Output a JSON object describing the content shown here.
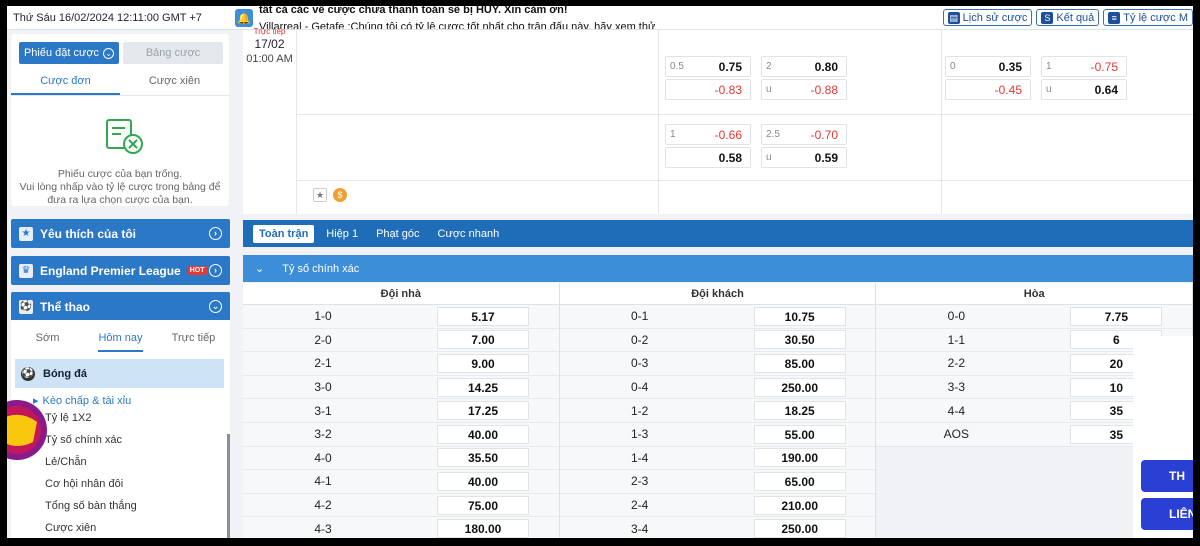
{
  "topbar": {
    "datetime": "Thứ Sáu 16/02/2024 12:11:00 GMT +7",
    "marquee_line1": "tất cả các về cược chưa thanh toán sẽ bị HỦY. Xin cảm ơn!",
    "marquee_line2": "Villarreal - Getafe :Chúng tôi có tỷ lệ cược tốt nhất cho trận đấu này, hãy xem thử",
    "buttons": [
      {
        "label": "Lịch sử cược",
        "icon": "history-icon"
      },
      {
        "label": "Kết quả",
        "icon": "results-icon"
      },
      {
        "label": "Tỷ lệ cược M",
        "icon": "odds-icon"
      }
    ]
  },
  "slip": {
    "tab_active": "Phiếu đặt cược",
    "tab_inactive": "Bảng cược",
    "sub_single": "Cược đơn",
    "sub_multi": "Cược xiên",
    "empty_line1": "Phiếu cược của bạn trống.",
    "empty_line2": "Vui lòng nhấp vào tỷ lệ cược trong bảng để",
    "empty_line3": "đưa ra lựa chọn cược của bạn."
  },
  "sidebar": {
    "favorites": "Yêu thích của tôi",
    "league": "England Premier League",
    "hot": "HOT",
    "sports": "Thể thao",
    "tabs": [
      "Sớm",
      "Hôm nay",
      "Trực tiếp"
    ],
    "sport_main": "Bóng đá",
    "sport_sub": "Kèo chấp & tài xỉu",
    "items": [
      "Tỷ lệ 1X2",
      "Tỷ số chính xác",
      "Lẻ/Chẵn",
      "Cơ hội nhân đôi",
      "Tổng số bàn thắng",
      "Cược xiên"
    ]
  },
  "match": {
    "live_label": "Trực tiếp",
    "date": "17/02",
    "time": "01:00 AM",
    "odds": [
      {
        "h": "0.5",
        "v": "0.75",
        "neg": false
      },
      {
        "h": "",
        "v": "-0.83",
        "neg": true
      },
      {
        "h": "2",
        "v": "0.80",
        "neg": false
      },
      {
        "h": "u",
        "v": "-0.88",
        "neg": true
      },
      {
        "h": "0",
        "v": "0.35",
        "neg": false
      },
      {
        "h": "",
        "v": "-0.45",
        "neg": true
      },
      {
        "h": "1",
        "v": "-0.75",
        "neg": true
      },
      {
        "h": "u",
        "v": "0.64",
        "neg": false
      },
      {
        "h": "1",
        "v": "-0.66",
        "neg": true
      },
      {
        "h": "",
        "v": "0.58",
        "neg": false
      },
      {
        "h": "2.5",
        "v": "-0.70",
        "neg": true
      },
      {
        "h": "u",
        "v": "0.59",
        "neg": false
      }
    ]
  },
  "tabs": [
    "Toàn trận",
    "Hiệp 1",
    "Phạt góc",
    "Cược nhanh"
  ],
  "section_title": "Tỷ số chính xác",
  "table": {
    "headers": [
      "Đội nhà",
      "Đội khách",
      "Hòa"
    ],
    "home": [
      [
        "1-0",
        "5.17"
      ],
      [
        "2-0",
        "7.00"
      ],
      [
        "2-1",
        "9.00"
      ],
      [
        "3-0",
        "14.25"
      ],
      [
        "3-1",
        "17.25"
      ],
      [
        "3-2",
        "40.00"
      ],
      [
        "4-0",
        "35.50"
      ],
      [
        "4-1",
        "40.00"
      ],
      [
        "4-2",
        "75.00"
      ],
      [
        "4-3",
        "180.00"
      ]
    ],
    "away": [
      [
        "0-1",
        "10.75"
      ],
      [
        "0-2",
        "30.50"
      ],
      [
        "0-3",
        "85.00"
      ],
      [
        "0-4",
        "250.00"
      ],
      [
        "1-2",
        "18.25"
      ],
      [
        "1-3",
        "55.00"
      ],
      [
        "1-4",
        "190.00"
      ],
      [
        "2-3",
        "65.00"
      ],
      [
        "2-4",
        "210.00"
      ],
      [
        "3-4",
        "250.00"
      ]
    ],
    "draw": [
      [
        "0-0",
        "7.75"
      ],
      [
        "1-1",
        "6"
      ],
      [
        "2-2",
        "20"
      ],
      [
        "3-3",
        "10"
      ],
      [
        "4-4",
        "35"
      ],
      [
        "AOS",
        "35"
      ]
    ]
  },
  "promo": {
    "btn1": "TH",
    "btn2": "LIÊN"
  },
  "colors": {
    "primary": "#2b78c6",
    "negative": "#e53935"
  }
}
